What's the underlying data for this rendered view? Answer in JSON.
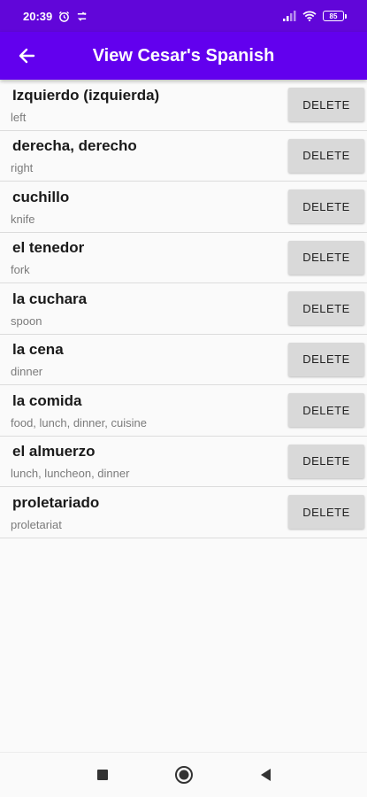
{
  "status_bar": {
    "time": "20:39",
    "battery_level": "85"
  },
  "app_bar": {
    "title": "View Cesar's Spanish"
  },
  "delete_label": "DELETE",
  "items": [
    {
      "word": "Izquierdo (izquierda)",
      "translation": "left"
    },
    {
      "word": "derecha, derecho",
      "translation": "right"
    },
    {
      "word": "cuchillo",
      "translation": "knife"
    },
    {
      "word": "el tenedor",
      "translation": "fork"
    },
    {
      "word": "la cuchara",
      "translation": "spoon"
    },
    {
      "word": "la cena",
      "translation": "dinner"
    },
    {
      "word": "la comida",
      "translation": "food, lunch, dinner, cuisine"
    },
    {
      "word": "el almuerzo",
      "translation": "lunch, luncheon, dinner"
    },
    {
      "word": "proletariado",
      "translation": "proletariat"
    }
  ],
  "colors": {
    "status_bar": "#6106d9",
    "app_bar": "#6200ee",
    "button": "#d9d9d9"
  }
}
